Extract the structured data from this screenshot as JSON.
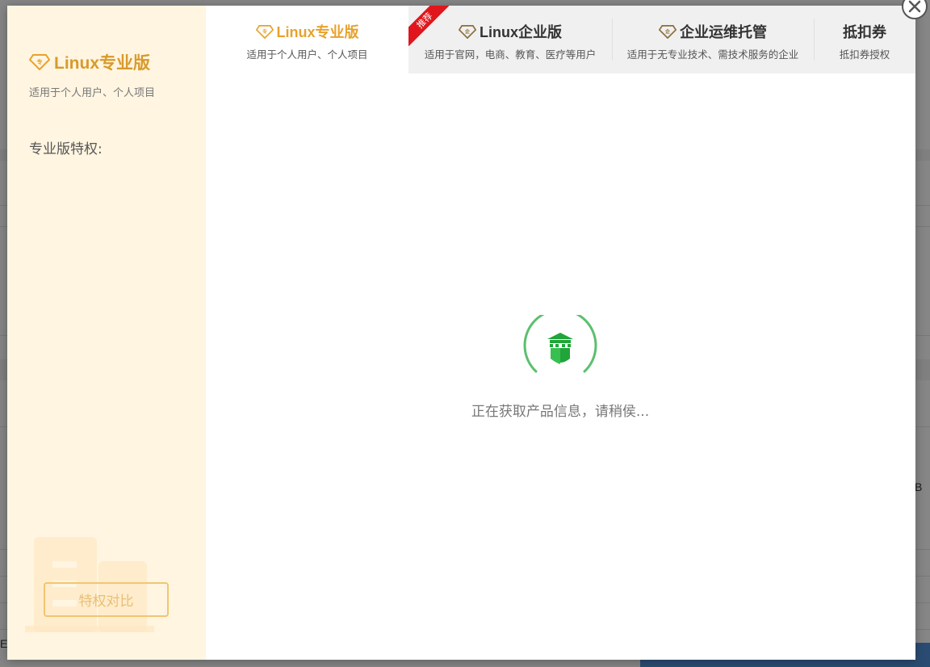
{
  "background": {
    "stray_letters": [
      "B",
      "E"
    ]
  },
  "dialog": {
    "close_icon": "close-icon",
    "sidebar": {
      "title": "Linux专业版",
      "title_icon": "diamond-pro-icon",
      "subtitle": "适用于个人用户、个人项目",
      "privileges_label": "专业版特权:",
      "compare_button": "特权对比"
    },
    "tabs": [
      {
        "title": "Linux专业版",
        "subtitle": "适用于个人用户、个人项目",
        "icon": "diamond-pro-icon",
        "active": true
      },
      {
        "title": "Linux企业版",
        "subtitle": "适用于官网，电商、教育、医疗等用户",
        "icon": "diamond-enterprise-icon",
        "ribbon": "推荐"
      },
      {
        "title": "企业运维托管",
        "subtitle": "适用于无专业技术、需技术服务的企业",
        "icon": "diamond-enterprise-icon"
      },
      {
        "title": "抵扣券",
        "subtitle": "抵扣券授权"
      }
    ],
    "loading": {
      "text": "正在获取产品信息，请稍侯...",
      "icon": "bt-castle-icon"
    }
  },
  "colors": {
    "accent_gold": "#e8a22d",
    "sidebar_bg": "#fff5e1",
    "ribbon_red": "#e0161c",
    "loader_green": "#20a53a"
  }
}
